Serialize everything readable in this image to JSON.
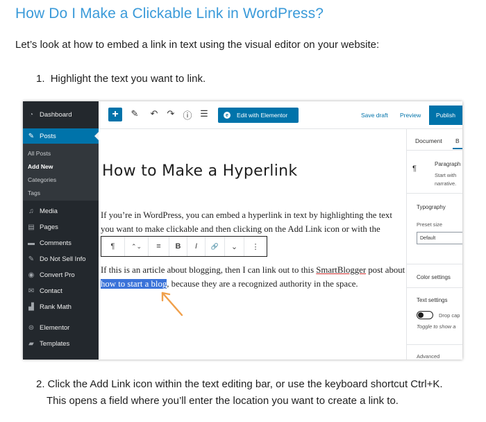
{
  "article": {
    "title": "How Do I Make a Clickable Link in WordPress?",
    "intro": "Let’s look at how to embed a link in text using the visual editor on your website:",
    "steps": [
      {
        "num": "1.",
        "text": "Highlight the text you want to link."
      },
      {
        "num": "2.",
        "line1": "Click the Add Link icon within the text editing bar, or use the keyboard shortcut Ctrl+K.",
        "line2": "This opens a field where you’ll enter the location you want to create a link to."
      }
    ]
  },
  "screenshot": {
    "sidebar": {
      "items": [
        {
          "label": "Dashboard",
          "icon": "dashboard-icon"
        },
        {
          "label": "Posts",
          "icon": "pin-icon"
        },
        {
          "label": "Media",
          "icon": "media-icon"
        },
        {
          "label": "Pages",
          "icon": "pages-icon"
        },
        {
          "label": "Comments",
          "icon": "comments-icon"
        },
        {
          "label": "Do Not Sell Info",
          "icon": "pin-icon"
        },
        {
          "label": "Convert Pro",
          "icon": "convert-pro-icon"
        },
        {
          "label": "Contact",
          "icon": "envelope-icon"
        },
        {
          "label": "Rank Math",
          "icon": "chart-icon"
        },
        {
          "label": "Elementor",
          "icon": "elementor-icon"
        },
        {
          "label": "Templates",
          "icon": "folder-icon"
        }
      ],
      "subitems": [
        "All Posts",
        "Add New",
        "Categories",
        "Tags"
      ]
    },
    "toolbar": {
      "plus": "+",
      "elementor_label": "Edit with Elementor",
      "save_draft": "Save draft",
      "preview": "Preview",
      "publish": "Publish"
    },
    "editor": {
      "post_title": "How to Make a Hyperlink",
      "para1": "If you’re in WordPress, you can embed a hyperlink in text by highlighting the text you want to make clickable and then clicking on the Add Link icon or with the",
      "para2_before": "If this is an article about blogging, then I can link out to this ",
      "para2_link": "SmartBlogger",
      "para2_mid": " post about ",
      "para2_selected": "how to start a blog",
      "para2_after": ", because they are a recognized authority in the space.",
      "block_toolbar": [
        "¶",
        "⌃⌄",
        "≡",
        "B",
        "I",
        "🔗",
        "⌄",
        "⋮"
      ]
    },
    "settings": {
      "tab_document": "Document",
      "tab_block": "B",
      "block_type": "Paragraph",
      "block_desc_1": "Start with",
      "block_desc_2": "narrative.",
      "typography": "Typography",
      "preset_size": "Preset size",
      "preset_value": "Default",
      "color_settings": "Color settings",
      "text_settings": "Text settings",
      "drop_cap": "Drop cap",
      "drop_cap_hint": "Toggle to show a",
      "advanced": "Advanced"
    }
  }
}
